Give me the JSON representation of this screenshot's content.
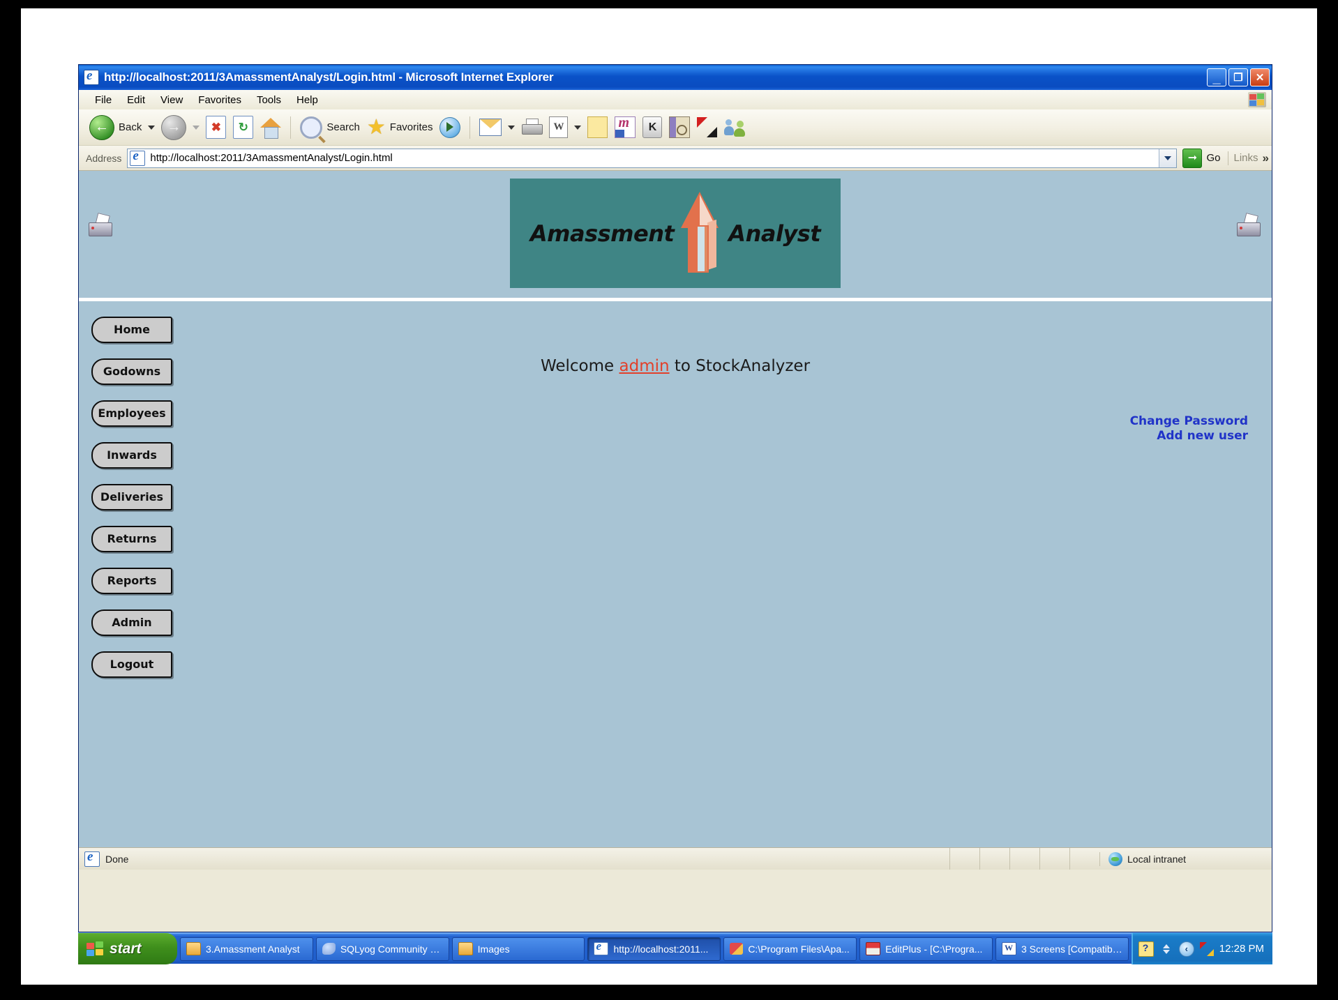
{
  "browser": {
    "title": "http://localhost:2011/3AmassmentAnalyst/Login.html - Microsoft Internet Explorer",
    "title_icon": "ie-document-icon",
    "window_buttons": {
      "minimize": "_",
      "restore": "❐",
      "close": "✕"
    },
    "menu": [
      "File",
      "Edit",
      "View",
      "Favorites",
      "Tools",
      "Help"
    ],
    "toolbar": {
      "back": "Back",
      "forward": "",
      "stop": "",
      "refresh": "",
      "home": "",
      "search": "Search",
      "favorites": "Favorites",
      "media": ""
    },
    "address": {
      "label": "Address",
      "url": "http://localhost:2011/3AmassmentAnalyst/Login.html",
      "go": "Go",
      "links": "Links",
      "chevron": "»"
    },
    "status": {
      "text": "Done",
      "zone": "Local intranet",
      "zone_icon": "globe-icon"
    }
  },
  "page": {
    "banner": {
      "left_word": "Amassment",
      "right_word": "Analyst",
      "logo_icon": "arrow-up-3d-logo",
      "bg_color": "#3f8585"
    },
    "corner_icons": {
      "left": "printer-icon",
      "right": "printer-icon"
    },
    "background_color": "#a8c4d4",
    "nav": [
      {
        "label": "Home"
      },
      {
        "label": "Godowns"
      },
      {
        "label": "Employees"
      },
      {
        "label": "Inwards"
      },
      {
        "label": "Deliveries"
      },
      {
        "label": "Returns"
      },
      {
        "label": "Reports"
      },
      {
        "label": "Admin"
      },
      {
        "label": "Logout"
      }
    ],
    "welcome": {
      "prefix": "Welcome ",
      "user": "admin",
      "suffix": " to StockAnalyzer"
    },
    "account_links": [
      {
        "label": "Change Password"
      },
      {
        "label": "Add new user"
      }
    ],
    "link_color": "#2033c8",
    "user_link_color": "#e2402a"
  },
  "taskbar": {
    "start": "start",
    "start_icon": "windows-flag-icon",
    "items": [
      {
        "label": "3.Amassment Analyst",
        "icon": "folder-icon",
        "active": false
      },
      {
        "label": "SQLyog Community E...",
        "icon": "sqlyog-icon",
        "active": false
      },
      {
        "label": "Images",
        "icon": "folder-icon",
        "active": false
      },
      {
        "label": "http://localhost:2011...",
        "icon": "ie-icon",
        "active": true
      },
      {
        "label": "C:\\Program Files\\Apa...",
        "icon": "apache-icon",
        "active": false
      },
      {
        "label": "EditPlus - [C:\\Progra...",
        "icon": "editplus-icon",
        "active": false
      },
      {
        "label": "3 Screens [Compatibil...",
        "icon": "word-icon",
        "active": false
      }
    ],
    "tray": {
      "help_icon": "help-balloon-icon",
      "network_icon": "network-icon",
      "arrows_icon": "updown-arrows-icon",
      "back_icon": "hide-tray-icon",
      "antivirus_icon": "kaspersky-icon",
      "clock": "12:28 PM"
    }
  }
}
